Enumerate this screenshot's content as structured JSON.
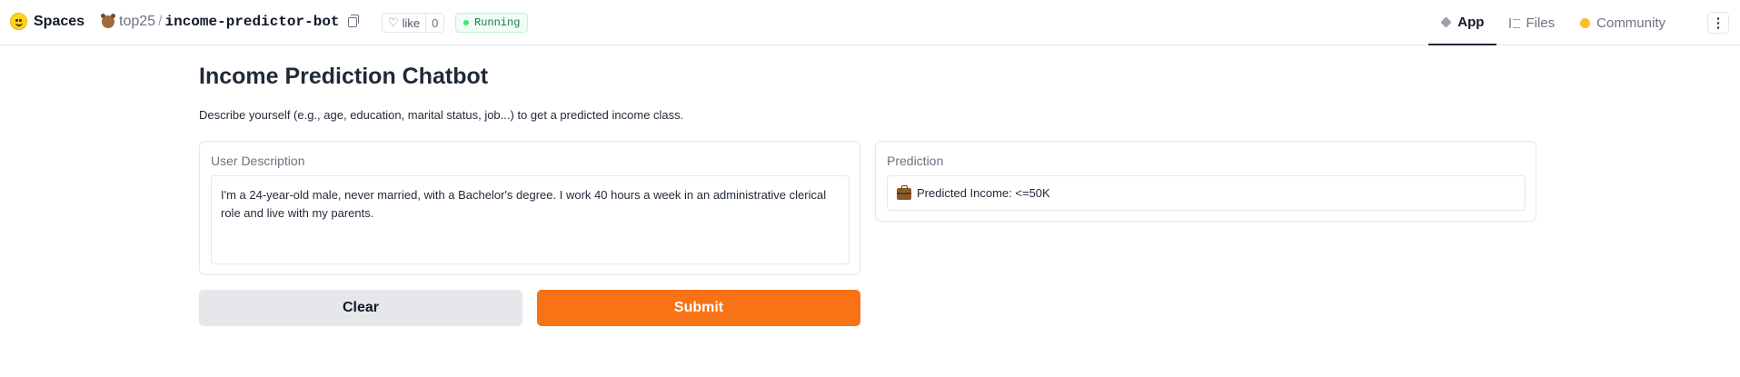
{
  "header": {
    "brand": "Spaces",
    "owner": "top25",
    "repo_name": "income-predictor-bot",
    "like_label": "like",
    "like_count": "0",
    "status": "Running",
    "tabs": [
      {
        "label": "App",
        "icon": "app-icon",
        "active": true
      },
      {
        "label": "Files",
        "icon": "files-icon",
        "active": false
      },
      {
        "label": "Community",
        "icon": "community-icon",
        "active": false
      }
    ],
    "menu_glyph": "⋮"
  },
  "main": {
    "title": "Income Prediction Chatbot",
    "description": "Describe yourself (e.g., age, education, marital status, job...) to get a predicted income class.",
    "input_panel": {
      "label": "User Description",
      "value": "I'm a 24-year-old male, never married, with a Bachelor's degree. I work 40 hours a week in an administrative clerical role and live with my parents."
    },
    "output_panel": {
      "label": "Prediction",
      "value": "Predicted Income: <=50K",
      "icon": "briefcase-icon"
    },
    "buttons": {
      "clear": "Clear",
      "submit": "Submit"
    }
  },
  "colors": {
    "accent": "#f97316",
    "status_green": "#15803d",
    "clear_bg": "#e5e7eb"
  }
}
